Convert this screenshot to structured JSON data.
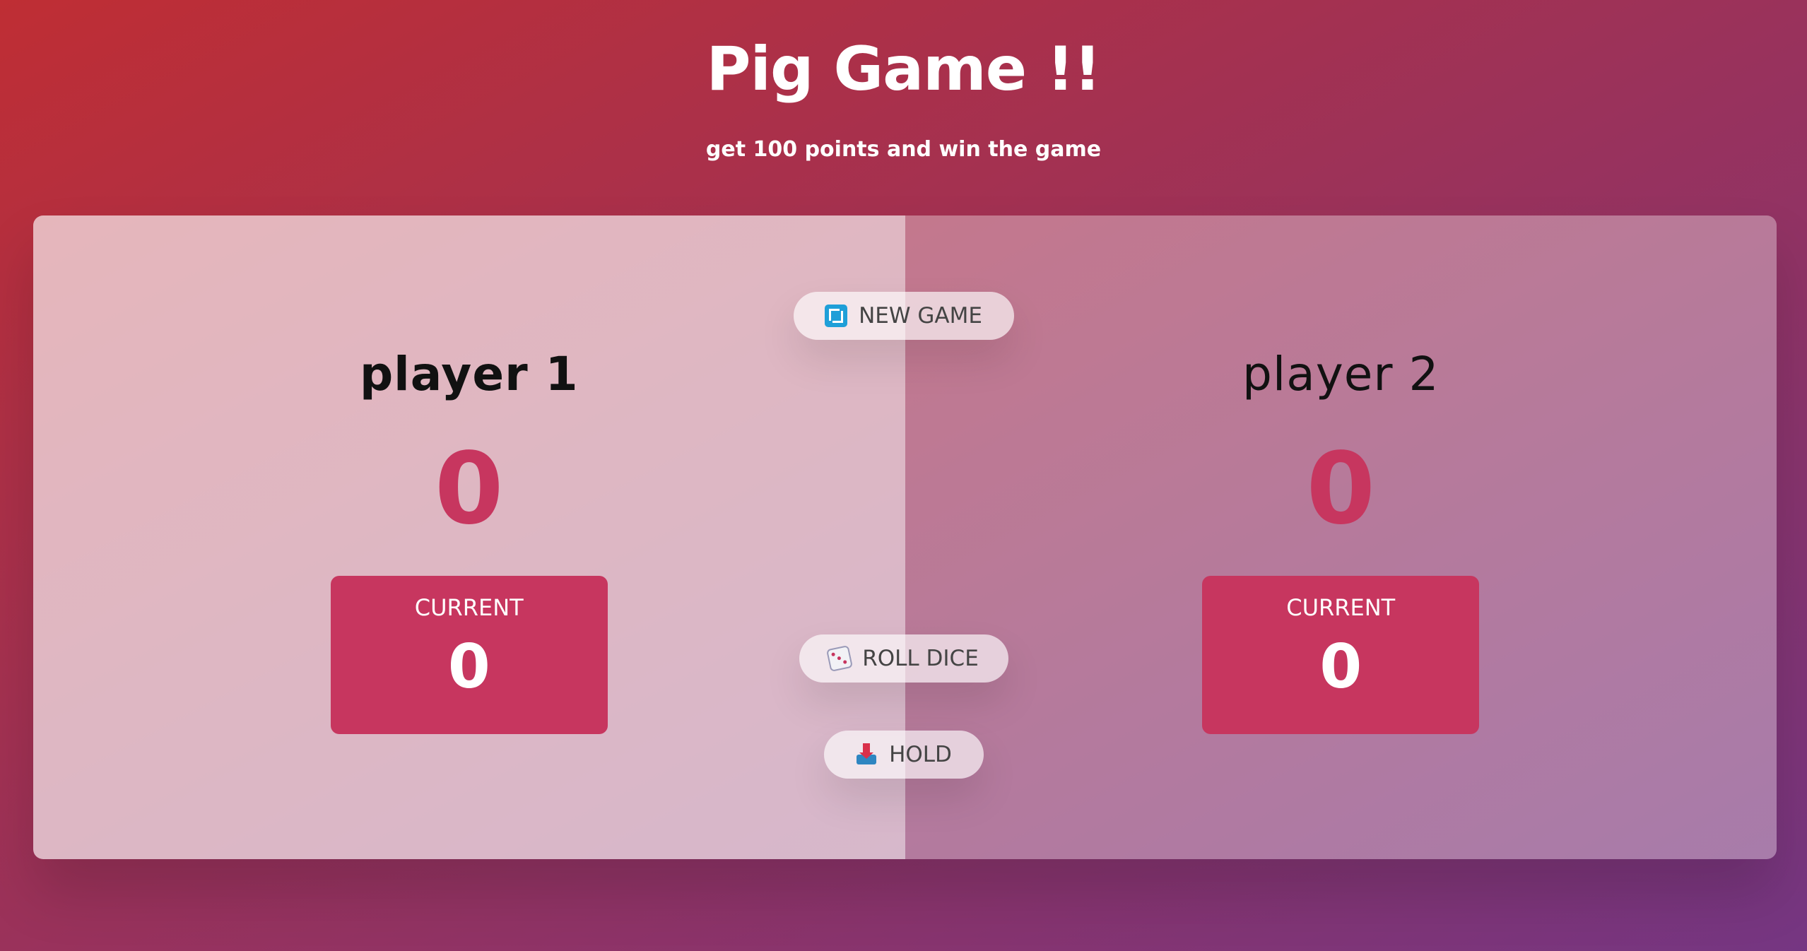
{
  "header": {
    "title": "Pig Game !!",
    "subtitle": "get 100 points and win the game"
  },
  "players": [
    {
      "name": "player 1",
      "score": "0",
      "current_label": "CURRENT",
      "current_score": "0",
      "active": true
    },
    {
      "name": "player 2",
      "score": "0",
      "current_label": "CURRENT",
      "current_score": "0",
      "active": false
    }
  ],
  "buttons": {
    "new_game": {
      "label": "NEW GAME",
      "icon": "refresh-icon"
    },
    "roll_dice": {
      "label": "ROLL DICE",
      "icon": "dice-icon"
    },
    "hold": {
      "label": "HOLD",
      "icon": "inbox-tray-icon"
    }
  },
  "colors": {
    "accent": "#c7365f",
    "gradient_start": "#bf2e34",
    "gradient_end": "#753682"
  }
}
